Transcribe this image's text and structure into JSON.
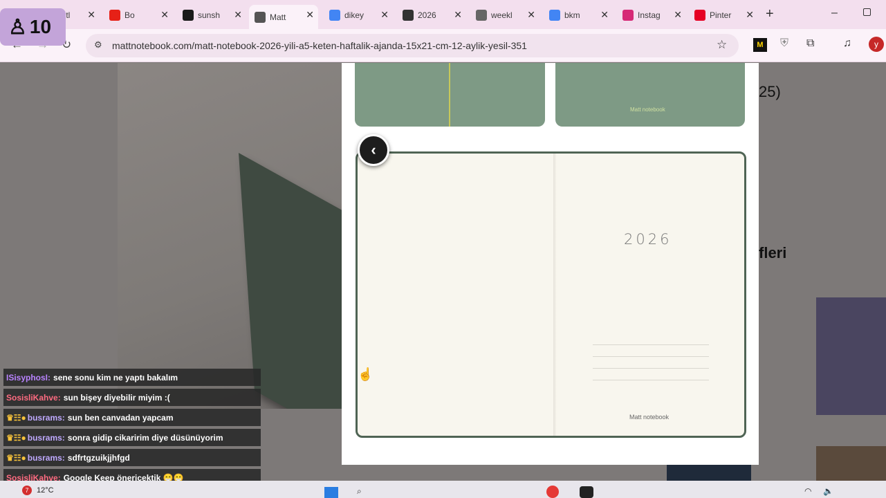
{
  "tabs": [
    {
      "title": "Untitl",
      "favicon": "doc-icon",
      "color": "#7e57c2"
    },
    {
      "title": "Bo",
      "favicon": "youtube-icon",
      "color": "#e62117"
    },
    {
      "title": "sunsh",
      "favicon": "k-icon",
      "color": "#1a1a1a"
    },
    {
      "title": "Matt",
      "favicon": "m-icon",
      "color": "#555555"
    },
    {
      "title": "dikey",
      "favicon": "google-icon",
      "color": "#4285f4"
    },
    {
      "title": "2026",
      "favicon": "chatgpt-icon",
      "color": "#333333"
    },
    {
      "title": "weekl",
      "favicon": "globe-icon",
      "color": "#666666"
    },
    {
      "title": "bkm",
      "favicon": "google-icon",
      "color": "#4285f4"
    },
    {
      "title": "Instag",
      "favicon": "instagram-icon",
      "color": "#d62976"
    },
    {
      "title": "Pinter",
      "favicon": "pinterest-icon",
      "color": "#e60023"
    }
  ],
  "url": "mattnotebook.com/matt-notebook-2026-yili-a5-keten-haftalik-ajanda-15x21-cm-12-aylik-yesil-351",
  "profile_initial": "y",
  "page": {
    "side_text_1": "25)",
    "side_text_2": "fleri",
    "thumb_brand": "Matt notebook",
    "year": "2026",
    "brand": "Matt notebook"
  },
  "overlay": {
    "viewer_count": "10",
    "chat": [
      {
        "user": "ISisyphosI:",
        "text": "sene sonu kim ne yaptı bakalım",
        "color": "#b983ff",
        "badges": ""
      },
      {
        "user": "SosisliKahve:",
        "text": "sun bişey diyebilir miyim :(",
        "color": "#ff6b81",
        "badges": ""
      },
      {
        "user": "busrams:",
        "text": "sun ben canvadan yapcam",
        "color": "#bfa9ff",
        "badges": "♛☷●"
      },
      {
        "user": "busrams:",
        "text": "sonra gidip cikaririm diye düsünüyorim",
        "color": "#bfa9ff",
        "badges": "♛☷●"
      },
      {
        "user": "busrams:",
        "text": "sdfrtgzuikjjhfgd",
        "color": "#bfa9ff",
        "badges": "♛☷●"
      },
      {
        "user": "SosisliKahve:",
        "text": "Google Keep önericektik 😁😁",
        "color": "#ff6b81",
        "badges": ""
      }
    ]
  },
  "taskbar": {
    "weather": "12°C",
    "notif_count": "7"
  }
}
